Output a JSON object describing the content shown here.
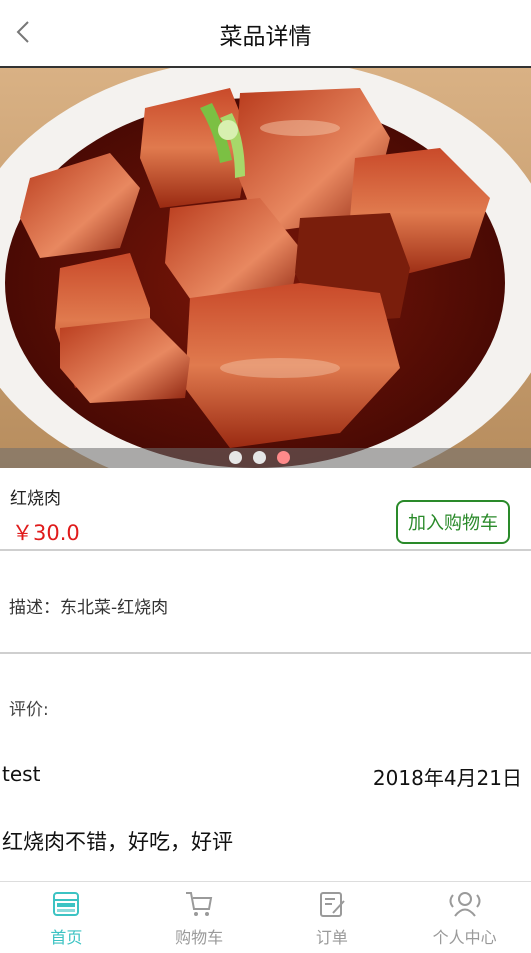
{
  "header": {
    "title": "菜品详情",
    "back_icon": "chevron-left-icon"
  },
  "carousel": {
    "slide_count": 3,
    "active_index": 2,
    "active_color": "#ff8a8a",
    "inactive_color": "#e6e6e6"
  },
  "dish": {
    "name": "红烧肉",
    "price": "￥30.0",
    "add_to_cart_label": "加入购物车"
  },
  "description": {
    "text": "描述：东北菜-红烧肉"
  },
  "reviews": {
    "title": "评价:",
    "items": [
      {
        "user": "test",
        "date": "2018年4月21日",
        "content": "红烧肉不错，好吃，好评"
      }
    ]
  },
  "tabbar": {
    "active_color": "#3cc3c3",
    "items": [
      {
        "label": "首页",
        "icon": "home-store-icon",
        "active": true
      },
      {
        "label": "购物车",
        "icon": "cart-icon",
        "active": false
      },
      {
        "label": "订单",
        "icon": "order-icon",
        "active": false
      },
      {
        "label": "个人中心",
        "icon": "user-group-icon",
        "active": false
      }
    ]
  },
  "colors": {
    "price": "#e01b1b",
    "add_button": "#2a8a2a"
  }
}
